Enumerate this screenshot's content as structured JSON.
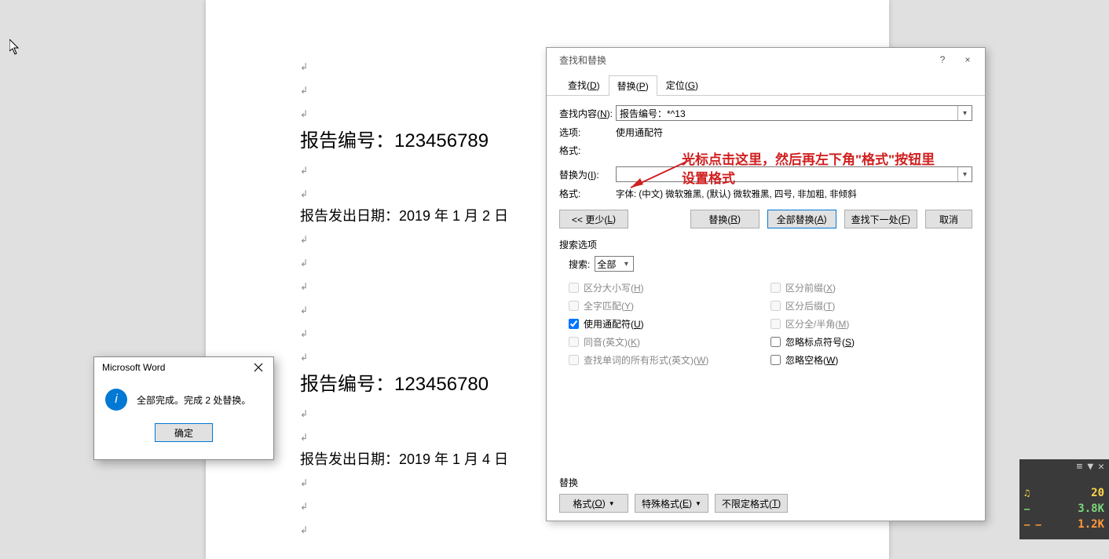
{
  "cursor": true,
  "document": {
    "lines": [
      "报告编号：123456789",
      "报告发出日期：2019 年 1 月 2 日",
      "报告编号：123456780",
      "报告发出日期：2019 年 1 月 4 日"
    ]
  },
  "dialog": {
    "title": "查找和替换",
    "help": "?",
    "close": "×",
    "tabs": {
      "find": "查找(D)",
      "replace": "替换(P)",
      "goto": "定位(G)"
    },
    "active_tab": "replace",
    "find_label": "查找内容(N):",
    "find_value": "报告编号：*^13",
    "options_label": "选项:",
    "options_value": "使用通配符",
    "format_label": "格式:",
    "replace_label": "替换为(I):",
    "replace_value": "",
    "replace_format_label": "格式:",
    "replace_format_value": "字体: (中文) 微软雅黑, (默认) 微软雅黑, 四号, 非加粗, 非倾斜",
    "annotation_line1": "光标点击这里，然后再左下角\"格式\"按钮里",
    "annotation_line2": "设置格式",
    "buttons": {
      "less": "<< 更少(L)",
      "replace": "替换(R)",
      "replace_all": "全部替换(A)",
      "find_next": "查找下一处(F)",
      "cancel": "取消"
    },
    "search_options_legend": "搜索选项",
    "search_label": "搜索:",
    "search_value": "全部",
    "opts": {
      "case": "区分大小写(H)",
      "whole": "全字匹配(Y)",
      "wildcard": "使用通配符(U)",
      "sounds": "同音(英文)(K)",
      "allforms": "查找单词的所有形式(英文)(W)",
      "prefix": "区分前缀(X)",
      "suffix": "区分后缀(T)",
      "fullhalf": "区分全/半角(M)",
      "punct": "忽略标点符号(S)",
      "space": "忽略空格(W)"
    },
    "replace_section": "替换",
    "bottom": {
      "format": "格式(O)",
      "special": "特殊格式(E)",
      "nofmt": "不限定格式(T)"
    }
  },
  "msgbox": {
    "title": "Microsoft Word",
    "text": "全部完成。完成 2 处替换。",
    "ok": "确定"
  },
  "syswidget": {
    "v1": "20",
    "v2": "3.8K",
    "v3": "1.2K"
  }
}
